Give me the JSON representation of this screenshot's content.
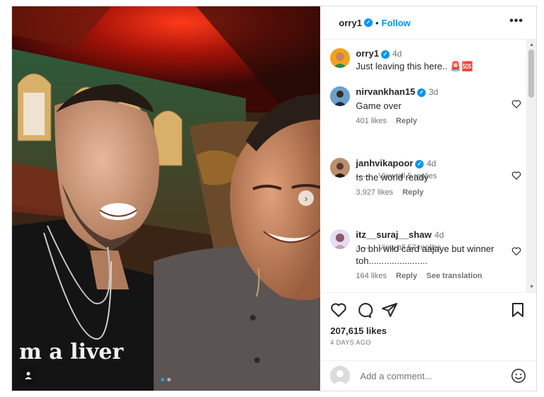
{
  "post": {
    "author": "orry1",
    "follow_label": "Follow",
    "more_label": "•••",
    "separator": "•",
    "media": {
      "next_arrow": "›",
      "carousel_count": 2,
      "active_index": 0,
      "photo_text": "m a liver"
    },
    "caption": {
      "user": "orry1",
      "time": "4d",
      "text": "Just leaving this here.. 🚨🆘"
    },
    "comments": [
      {
        "user": "nirvankhan15",
        "verified": true,
        "time": "3d",
        "text": "Game over",
        "likes": "401 likes",
        "reply": "Reply",
        "view_replies": "View all 5 replies"
      },
      {
        "user": "janhvikapoor",
        "verified": true,
        "time": "4d",
        "text": "Is the world ready",
        "likes": "3,927 likes",
        "reply": "Reply",
        "view_replies": "View all 57 replies"
      },
      {
        "user": "itz__suraj__shaw",
        "verified": false,
        "time": "4d",
        "text": "Jo bhi wild card aajaye but winner toh.......................",
        "likes": "164 likes",
        "reply": "Reply",
        "translate": "See translation"
      }
    ],
    "likes_count": "207,615 likes",
    "date": "4 DAYS AGO",
    "add_comment_placeholder": "Add a comment...",
    "colors": {
      "accent": "#0095f6",
      "text": "#262626",
      "muted": "#737373"
    }
  }
}
